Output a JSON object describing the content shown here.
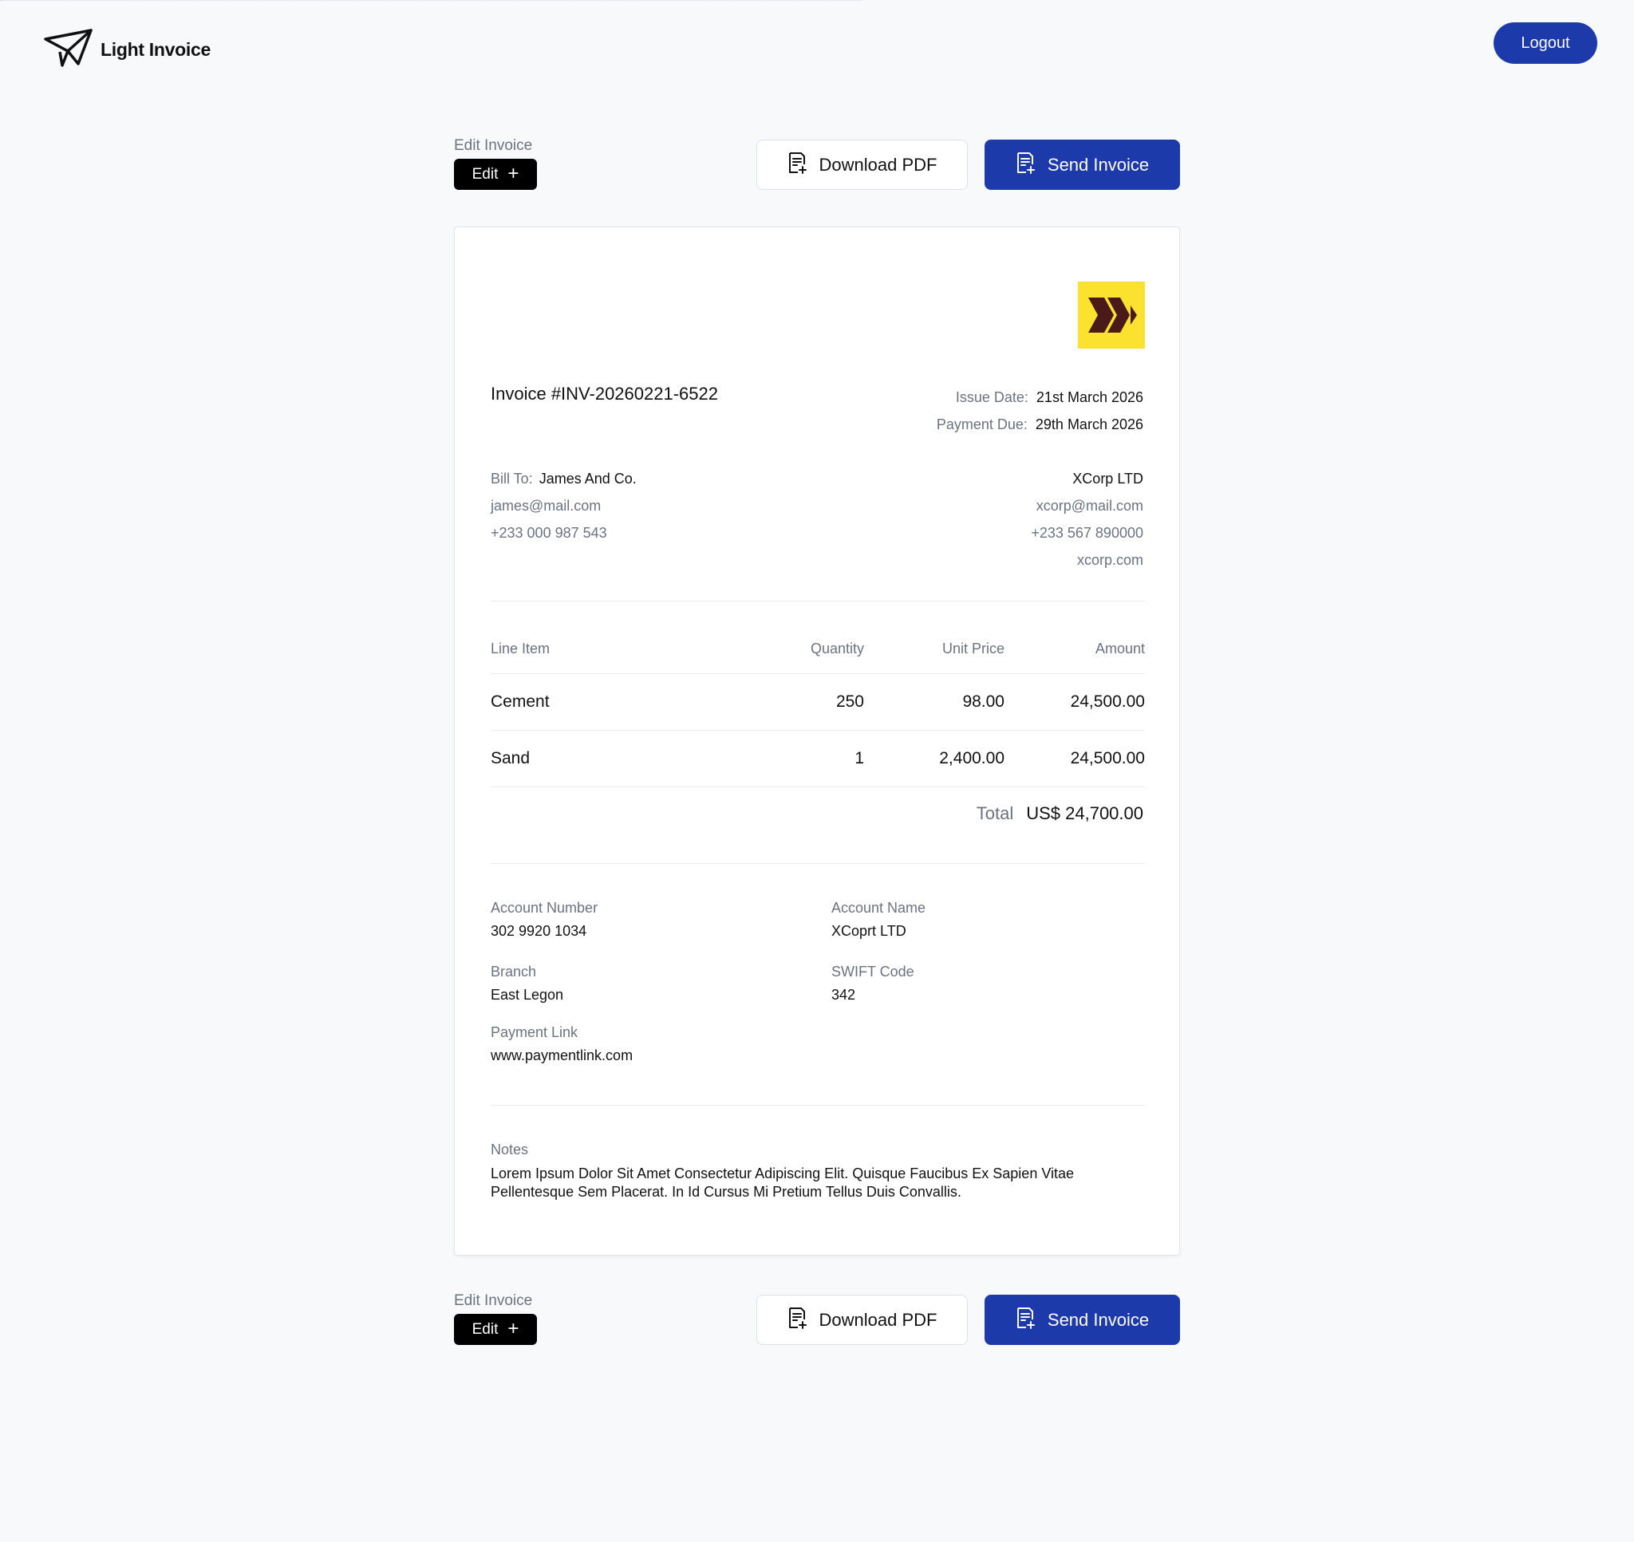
{
  "app": {
    "name": "Light Invoice",
    "logout_label": "Logout"
  },
  "toolbar": {
    "edit_section_label": "Edit Invoice",
    "edit_label": "Edit",
    "download_label": "Download PDF",
    "send_label": "Send Invoice"
  },
  "invoice": {
    "number": "Invoice #INV-20260221-6522",
    "issue_date_label": "Issue Date:",
    "issue_date": "21st March 2026",
    "due_label": "Payment Due:",
    "due_date": "29th March 2026",
    "bill_to": {
      "label": "Bill To:",
      "name": "James And Co.",
      "email": "james@mail.com",
      "phone": "+233 000 987 543"
    },
    "from": {
      "name": "XCorp LTD",
      "email": "xcorp@mail.com",
      "phone": "+233 567 890000",
      "website": "xcorp.com"
    },
    "columns": [
      "Line Item",
      "Quantity",
      "Unit Price",
      "Amount"
    ],
    "items": [
      {
        "name": "Cement",
        "qty": "250",
        "unit_price": "98.00",
        "amount": "24,500.00"
      },
      {
        "name": "Sand",
        "qty": "1",
        "unit_price": "2,400.00",
        "amount": "24,500.00"
      }
    ],
    "total_label": "Total",
    "total_value": "US$ 24,700.00",
    "payment": {
      "account_number_label": "Account Number",
      "account_number": "302 9920 1034",
      "account_name_label": "Account Name",
      "account_name": "XCoprt LTD",
      "branch_label": "Branch",
      "branch": "East Legon",
      "swift_label": "SWIFT Code",
      "swift": "342",
      "link_label": "Payment Link",
      "link": "www.paymentlink.com"
    },
    "notes_label": "Notes",
    "notes": "Lorem Ipsum Dolor Sit Amet Consectetur Adipiscing Elit. Quisque Faucibus Ex Sapien Vitae Pellentesque Sem Placerat. In Id Cursus Mi Pretium Tellus Duis Convallis."
  },
  "colors": {
    "accent": "#1d3aab",
    "logo_yellow": "#fbe22f",
    "logo_mark": "#4a1a1a"
  },
  "icons": {
    "brand": "paper-plane-icon",
    "company_logo": "chevrons-logo",
    "document": "document-plus-icon"
  }
}
